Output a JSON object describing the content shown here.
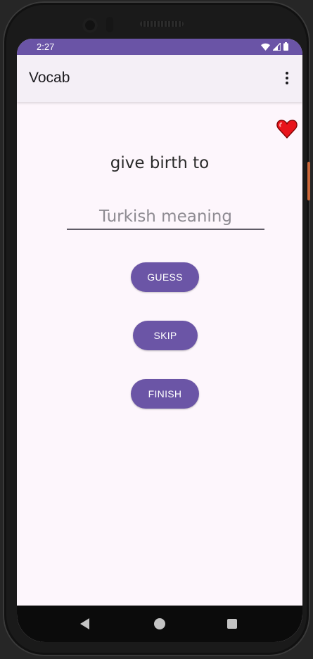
{
  "status_bar": {
    "time": "2:27",
    "icons": [
      "wifi-icon",
      "signal-icon",
      "battery-icon"
    ]
  },
  "app_bar": {
    "title": "Vocab",
    "menu_icon": "more-vert-icon"
  },
  "lives_icon": "heart-icon",
  "quiz": {
    "word": "give birth to",
    "input_value": "",
    "input_placeholder": "Turkish meaning",
    "guess_label": "GUESS",
    "skip_label": "SKIP",
    "finish_label": "FINISH"
  },
  "nav_bar": {
    "icons": [
      "back-icon",
      "home-icon",
      "recents-icon"
    ]
  },
  "colors": {
    "primary": "#6b55a6",
    "status_bar": "#6a54a6",
    "background": "#fdf6fc",
    "heart": "#e8141b"
  }
}
